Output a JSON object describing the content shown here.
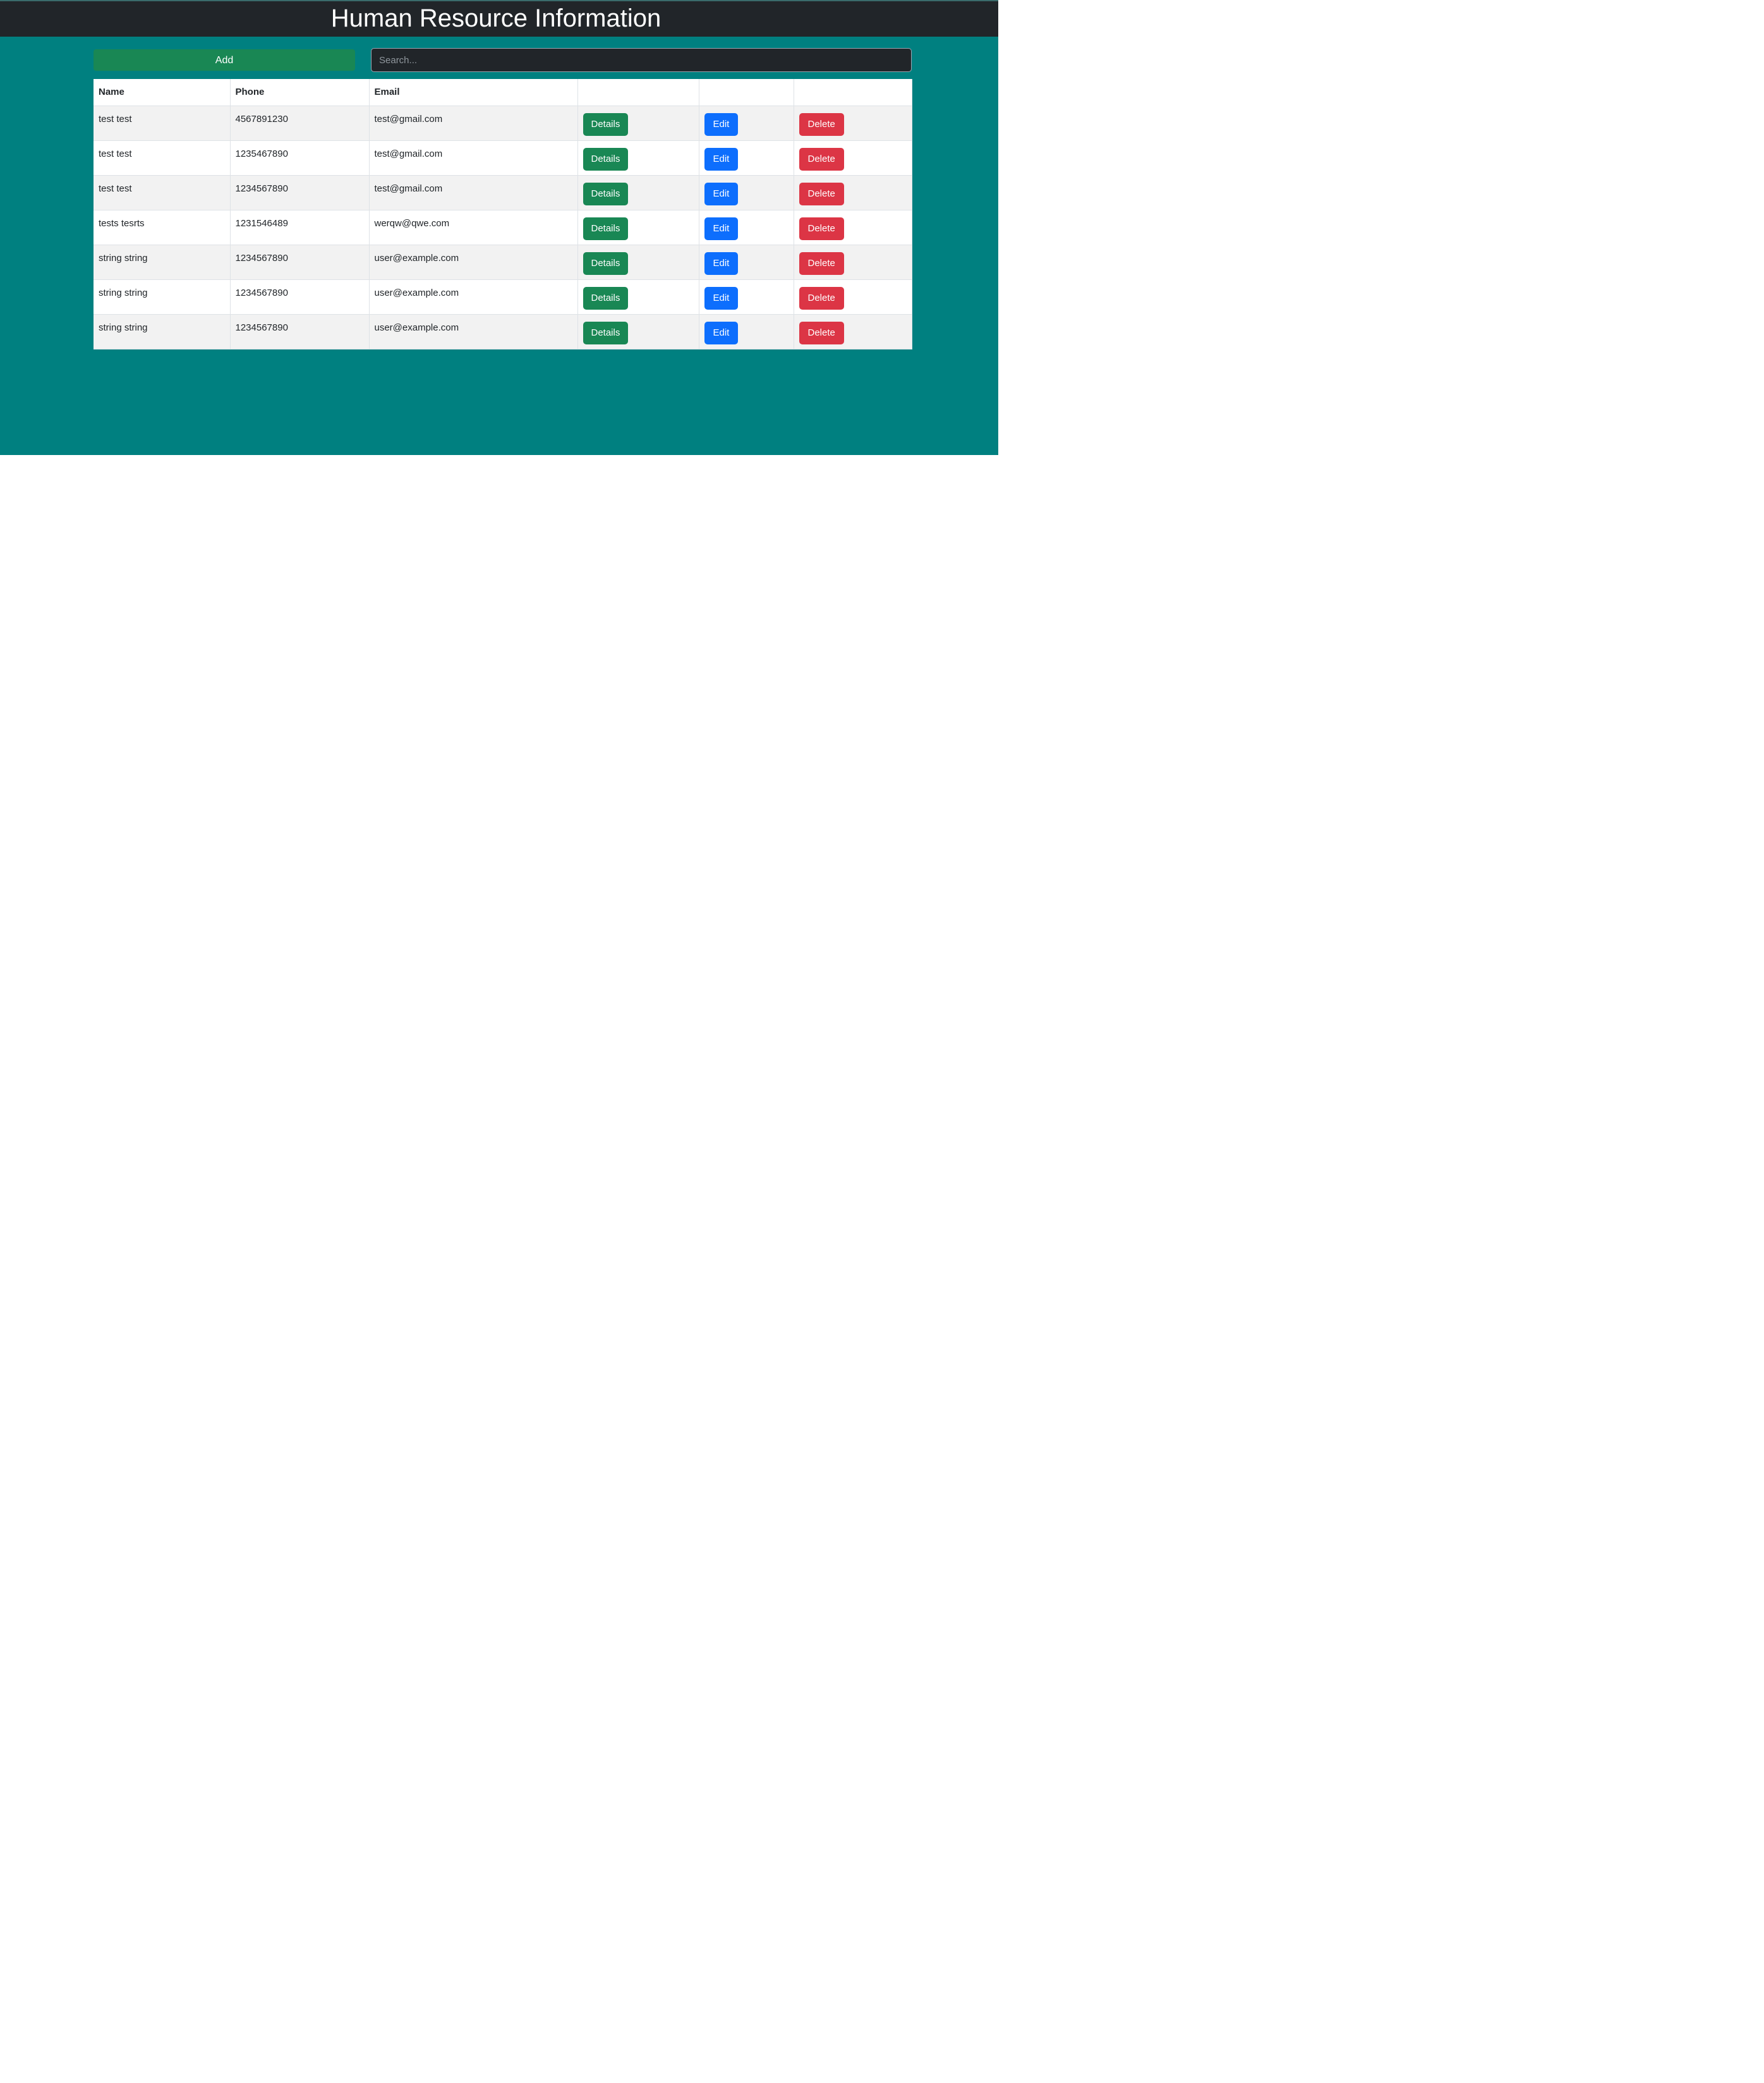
{
  "header": {
    "title": "Human Resource Information"
  },
  "toolbar": {
    "add_label": "Add",
    "search_placeholder": "Search..."
  },
  "table": {
    "columns": [
      "Name",
      "Phone",
      "Email",
      "",
      "",
      ""
    ],
    "button_labels": {
      "details": "Details",
      "edit": "Edit",
      "delete": "Delete"
    },
    "rows": [
      {
        "name": "test test",
        "phone": "4567891230",
        "email": "test@gmail.com"
      },
      {
        "name": "test test",
        "phone": "1235467890",
        "email": "test@gmail.com"
      },
      {
        "name": "test test",
        "phone": "1234567890",
        "email": "test@gmail.com"
      },
      {
        "name": "tests tesrts",
        "phone": "1231546489",
        "email": "werqw@qwe.com"
      },
      {
        "name": "string string",
        "phone": "1234567890",
        "email": "user@example.com"
      },
      {
        "name": "string string",
        "phone": "1234567890",
        "email": "user@example.com"
      },
      {
        "name": "string string",
        "phone": "1234567890",
        "email": "user@example.com"
      }
    ]
  },
  "colors": {
    "page_background": "#008080",
    "header_background": "#212529",
    "details_button": "#198754",
    "edit_button": "#0d6efd",
    "delete_button": "#dc3545",
    "add_button": "#198754"
  }
}
